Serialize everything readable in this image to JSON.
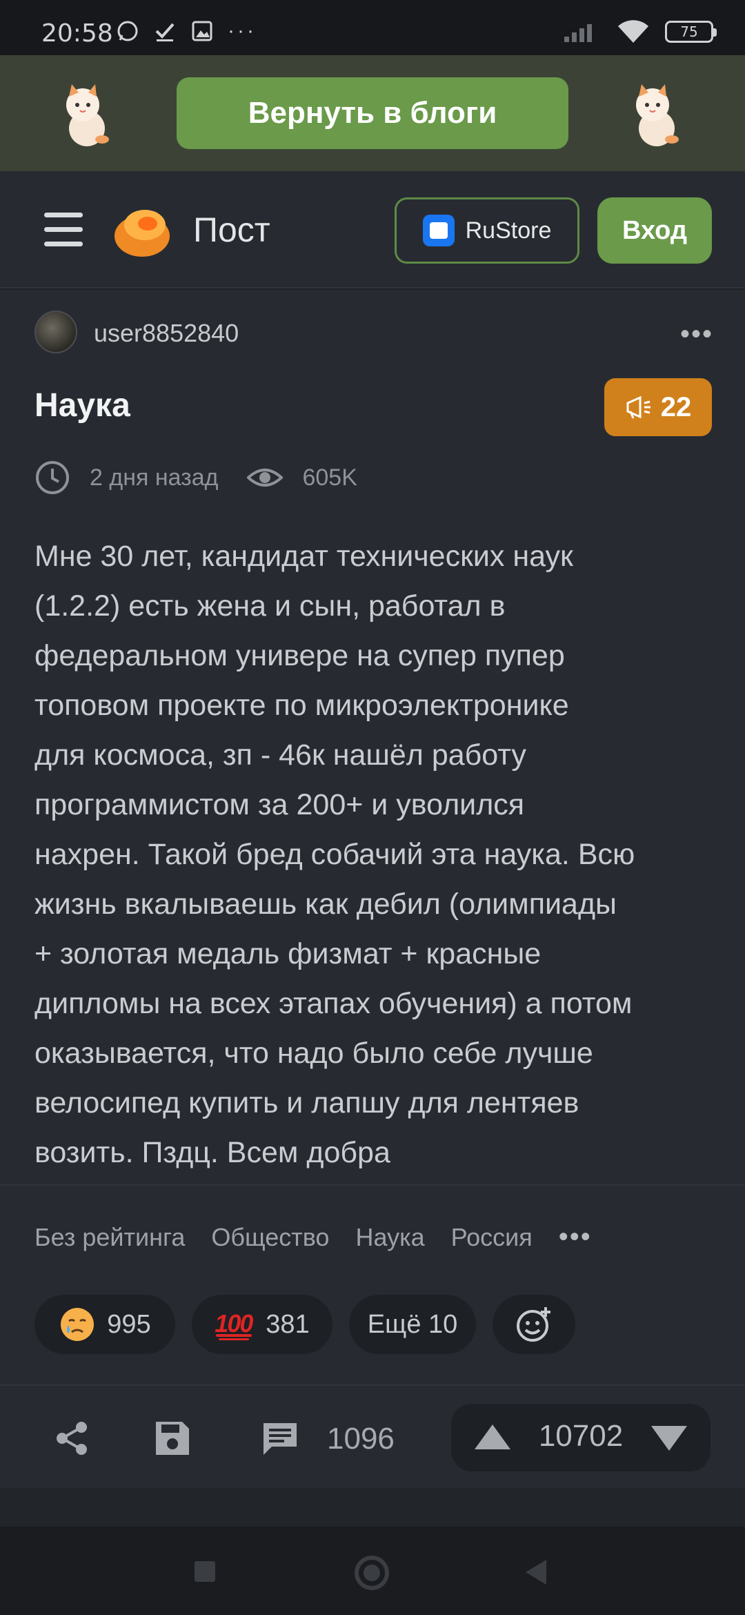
{
  "status_bar": {
    "time": "20:58",
    "battery": "75"
  },
  "banner": {
    "back_button": "Вернуть в блоги"
  },
  "header": {
    "title": "Пост",
    "rustore_label": "RuStore",
    "login_label": "Вход"
  },
  "post": {
    "author": "user8852840",
    "title": "Наука",
    "badge_count": "22",
    "time_ago": "2 дня назад",
    "views": "605K",
    "text_lines": [
      "Мне 30 лет, кандидат технических наук",
      "(1.2.2) есть жена и сын, работал в",
      "федеральном универе на супер пупер",
      "топовом проекте по микроэлектронике",
      "для космоса, зп - 46к нашёл работу",
      "программистом за 200+ и уволился",
      "нахрен. Такой бред собачий эта наука. Всю",
      "жизнь вкалываешь как дебил (олимпиады",
      "+ золотая медаль физмат + красные",
      "дипломы на всех этапах обучения) а потом",
      "оказывается, что надо было себе лучше",
      "велосипед купить и лапшу для лентяев",
      "возить. Пздц. Всем добра"
    ]
  },
  "tags": [
    "Без рейтинга",
    "Общество",
    "Наука",
    "Россия"
  ],
  "reactions": {
    "sad_count": "995",
    "hundred_count": "381",
    "more_label": "Ещё 10",
    "hundred_emoji": "100"
  },
  "actions": {
    "comments": "1096",
    "score": "10702"
  },
  "colors": {
    "accent_green": "#6a9a4a",
    "badge_orange": "#d1811b",
    "background": "#272b31"
  }
}
